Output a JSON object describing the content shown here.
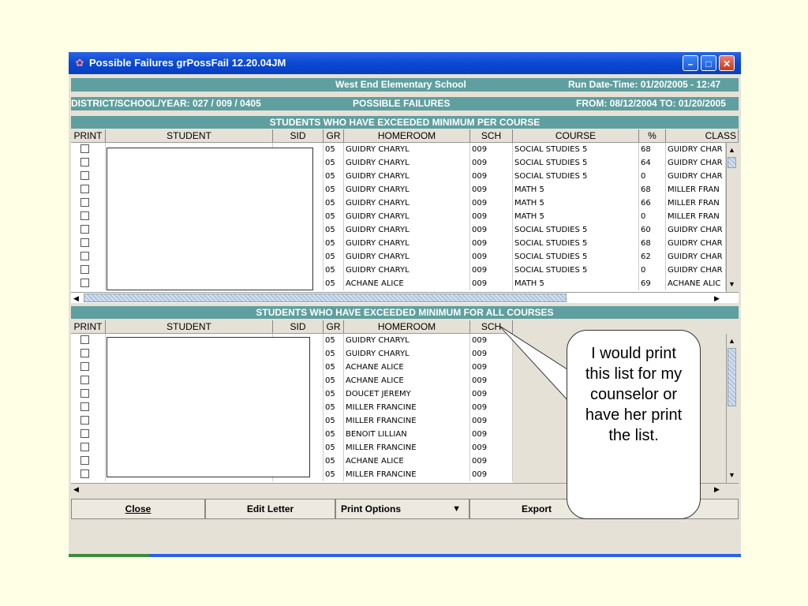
{
  "window": {
    "title": "Possible Failures   grPossFail 12.20.04JM",
    "minimize_icon": "minimize-icon",
    "maximize_icon": "maximize-icon",
    "close_icon": "close-icon"
  },
  "header": {
    "school": "West End Elementary School",
    "run_date": "Run Date-Time: 01/20/2005  -  12:47",
    "district": "DISTRICT/SCHOOL/YEAR: 027 / 009 / 0405",
    "report": "POSSIBLE FAILURES",
    "from_to": "FROM: 08/12/2004 TO: 01/20/2005"
  },
  "section1": {
    "title": "STUDENTS WHO HAVE EXCEEDED MINIMUM PER COURSE",
    "columns": {
      "print": "PRINT",
      "student": "STUDENT",
      "sid": "SID",
      "gr": "GR",
      "homeroom": "HOMEROOM",
      "sch": "SCH",
      "course": "COURSE",
      "pct": "%",
      "class": "CLASS"
    },
    "rows": [
      {
        "gr": "05",
        "homeroom": "GUIDRY CHARYL",
        "sch": "009",
        "course": "SOCIAL STUDIES 5",
        "pct": "68",
        "class": "GUIDRY CHAR"
      },
      {
        "gr": "05",
        "homeroom": "GUIDRY CHARYL",
        "sch": "009",
        "course": "SOCIAL STUDIES 5",
        "pct": "64",
        "class": "GUIDRY CHAR"
      },
      {
        "gr": "05",
        "homeroom": "GUIDRY CHARYL",
        "sch": "009",
        "course": "SOCIAL STUDIES 5",
        "pct": "0",
        "class": "GUIDRY CHAR"
      },
      {
        "gr": "05",
        "homeroom": "GUIDRY CHARYL",
        "sch": "009",
        "course": "MATH 5",
        "pct": "68",
        "class": "MILLER FRAN"
      },
      {
        "gr": "05",
        "homeroom": "GUIDRY CHARYL",
        "sch": "009",
        "course": "MATH 5",
        "pct": "66",
        "class": "MILLER FRAN"
      },
      {
        "gr": "05",
        "homeroom": "GUIDRY CHARYL",
        "sch": "009",
        "course": "MATH 5",
        "pct": "0",
        "class": "MILLER FRAN"
      },
      {
        "gr": "05",
        "homeroom": "GUIDRY CHARYL",
        "sch": "009",
        "course": "SOCIAL STUDIES 5",
        "pct": "60",
        "class": "GUIDRY CHAR"
      },
      {
        "gr": "05",
        "homeroom": "GUIDRY CHARYL",
        "sch": "009",
        "course": "SOCIAL STUDIES 5",
        "pct": "68",
        "class": "GUIDRY CHAR"
      },
      {
        "gr": "05",
        "homeroom": "GUIDRY CHARYL",
        "sch": "009",
        "course": "SOCIAL STUDIES 5",
        "pct": "62",
        "class": "GUIDRY CHAR"
      },
      {
        "gr": "05",
        "homeroom": "GUIDRY CHARYL",
        "sch": "009",
        "course": "SOCIAL STUDIES 5",
        "pct": "0",
        "class": "GUIDRY CHAR"
      },
      {
        "gr": "05",
        "homeroom": "ACHANE ALICE",
        "sch": "009",
        "course": "MATH 5",
        "pct": "69",
        "class": "ACHANE ALIC"
      }
    ]
  },
  "section2": {
    "title": "STUDENTS WHO HAVE EXCEEDED MINIMUM FOR ALL COURSES",
    "columns": {
      "print": "PRINT",
      "student": "STUDENT",
      "sid": "SID",
      "gr": "GR",
      "homeroom": "HOMEROOM",
      "sch": "SCH"
    },
    "rows": [
      {
        "gr": "05",
        "homeroom": "GUIDRY CHARYL",
        "sch": "009"
      },
      {
        "gr": "05",
        "homeroom": "GUIDRY CHARYL",
        "sch": "009"
      },
      {
        "gr": "05",
        "homeroom": "ACHANE ALICE",
        "sch": "009"
      },
      {
        "gr": "05",
        "homeroom": "ACHANE ALICE",
        "sch": "009"
      },
      {
        "gr": "05",
        "homeroom": "DOUCET JEREMY",
        "sch": "009"
      },
      {
        "gr": "05",
        "homeroom": "MILLER FRANCINE",
        "sch": "009"
      },
      {
        "gr": "05",
        "homeroom": "MILLER FRANCINE",
        "sch": "009"
      },
      {
        "gr": "05",
        "homeroom": "BENOIT LILLIAN",
        "sch": "009"
      },
      {
        "gr": "05",
        "homeroom": "MILLER FRANCINE",
        "sch": "009"
      },
      {
        "gr": "05",
        "homeroom": "ACHANE ALICE",
        "sch": "009"
      },
      {
        "gr": "05",
        "homeroom": "MILLER FRANCINE",
        "sch": "009"
      }
    ]
  },
  "buttons": {
    "close": "Close",
    "edit_letter": "Edit Letter",
    "print_options": "Print Options",
    "export": "Export"
  },
  "callout": {
    "text": "I would print this list for my counselor or have her print the list."
  },
  "colors": {
    "background": "#ffffe5",
    "header_teal": "#5f9f9f",
    "titlebar_blue": "#0a49d2"
  }
}
